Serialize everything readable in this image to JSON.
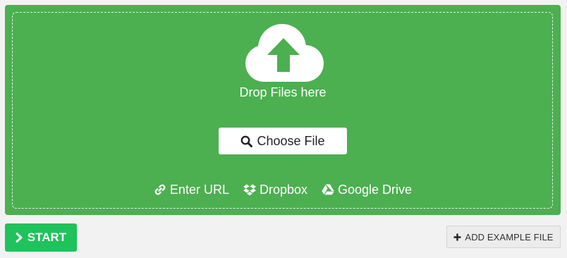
{
  "upload_area": {
    "drop_text": "Drop Files here",
    "choose_file_label": "Choose File",
    "background_color": "#4caf50",
    "icons": {
      "cloud": "cloud-upload-icon",
      "choose": "search-icon"
    }
  },
  "sources": [
    {
      "label": "Enter URL",
      "icon": "link-icon"
    },
    {
      "label": "Dropbox",
      "icon": "dropbox-icon"
    },
    {
      "label": "Google Drive",
      "icon": "google-drive-icon"
    }
  ],
  "actions": {
    "start_label": "START",
    "start_color": "#1fc25b",
    "start_icon": "chevron-right-icon",
    "example_label": "ADD EXAMPLE FILE",
    "example_icon": "plus-icon"
  }
}
